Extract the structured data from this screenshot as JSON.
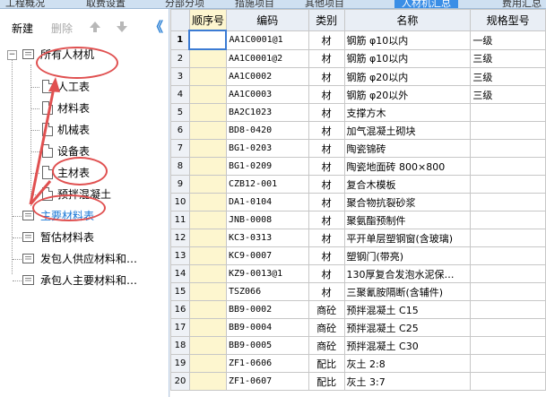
{
  "top_tabs": [
    "工程概况",
    "取费设置",
    "分部分项",
    "措施项目",
    "其他项目",
    "人材机汇总",
    "费用汇总"
  ],
  "toolbar": {
    "new_label": "新建",
    "delete_label": "删除",
    "collapse_icon": "《"
  },
  "tree": {
    "root": "所有人材机",
    "children": [
      "人工表",
      "材料表",
      "机械表",
      "设备表",
      "主材表",
      "预拌混凝土"
    ],
    "groups": [
      "主要材料表",
      "暂估材料表",
      "发包人供应材料和…",
      "承包人主要材料和…"
    ]
  },
  "table": {
    "columns": [
      "",
      "顺序号",
      "编码",
      "类别",
      "名称",
      "规格型号"
    ],
    "rows": [
      {
        "n": "1",
        "seq": "",
        "code": "AA1C0001@1",
        "cat": "材",
        "name": "钢筋 φ10以内",
        "spec": "一级"
      },
      {
        "n": "2",
        "seq": "",
        "code": "AA1C0001@2",
        "cat": "材",
        "name": "钢筋 φ10以内",
        "spec": "三级"
      },
      {
        "n": "3",
        "seq": "",
        "code": "AA1C0002",
        "cat": "材",
        "name": "钢筋 φ20以内",
        "spec": "三级"
      },
      {
        "n": "4",
        "seq": "",
        "code": "AA1C0003",
        "cat": "材",
        "name": "钢筋 φ20以外",
        "spec": "三级"
      },
      {
        "n": "5",
        "seq": "",
        "code": "BA2C1023",
        "cat": "材",
        "name": "支撑方木",
        "spec": ""
      },
      {
        "n": "6",
        "seq": "",
        "code": "BD8-0420",
        "cat": "材",
        "name": "加气混凝土砌块",
        "spec": ""
      },
      {
        "n": "7",
        "seq": "",
        "code": "BG1-0203",
        "cat": "材",
        "name": "陶瓷锦砖",
        "spec": ""
      },
      {
        "n": "8",
        "seq": "",
        "code": "BG1-0209",
        "cat": "材",
        "name": "陶瓷地面砖 800×800",
        "spec": ""
      },
      {
        "n": "9",
        "seq": "",
        "code": "CZB12-001",
        "cat": "材",
        "name": "复合木模板",
        "spec": ""
      },
      {
        "n": "10",
        "seq": "",
        "code": "DA1-0104",
        "cat": "材",
        "name": "聚合物抗裂砂浆",
        "spec": ""
      },
      {
        "n": "11",
        "seq": "",
        "code": "JNB-0008",
        "cat": "材",
        "name": "聚氨酯预制件",
        "spec": ""
      },
      {
        "n": "12",
        "seq": "",
        "code": "KC3-0313",
        "cat": "材",
        "name": "平开单层塑钢窗(含玻璃)",
        "spec": ""
      },
      {
        "n": "13",
        "seq": "",
        "code": "KC9-0007",
        "cat": "材",
        "name": "塑钢门(带亮)",
        "spec": ""
      },
      {
        "n": "14",
        "seq": "",
        "code": "KZ9-0013@1",
        "cat": "材",
        "name": "130厚复合发泡水泥保…",
        "spec": ""
      },
      {
        "n": "15",
        "seq": "",
        "code": "TSZ066",
        "cat": "材",
        "name": "三聚氰胺隔断(含辅件)",
        "spec": ""
      },
      {
        "n": "16",
        "seq": "",
        "code": "BB9-0002",
        "cat": "商砼",
        "name": "预拌混凝土 C15",
        "spec": ""
      },
      {
        "n": "17",
        "seq": "",
        "code": "BB9-0004",
        "cat": "商砼",
        "name": "预拌混凝土 C25",
        "spec": ""
      },
      {
        "n": "18",
        "seq": "",
        "code": "BB9-0005",
        "cat": "商砼",
        "name": "预拌混凝土 C30",
        "spec": ""
      },
      {
        "n": "19",
        "seq": "",
        "code": "ZF1-0606",
        "cat": "配比",
        "name": "灰土 2:8",
        "spec": ""
      },
      {
        "n": "20",
        "seq": "",
        "code": "ZF1-0607",
        "cat": "配比",
        "name": "灰土 3:7",
        "spec": ""
      }
    ]
  }
}
